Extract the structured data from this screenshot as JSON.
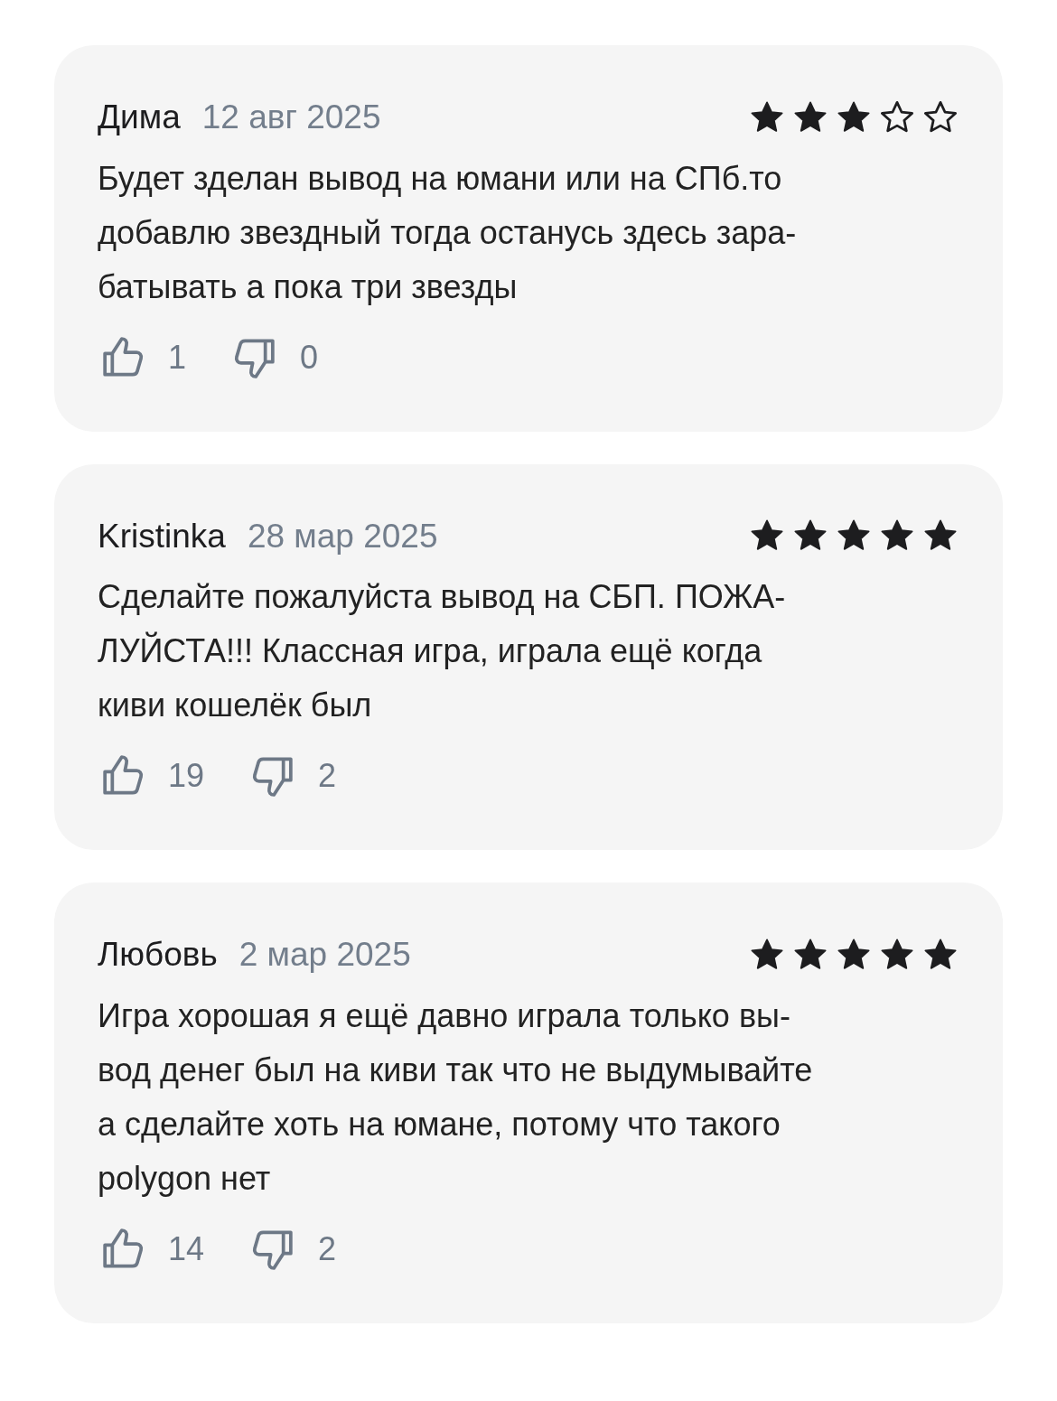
{
  "reviews": [
    {
      "author": "Дима",
      "date": "12 авг 2025",
      "stars": 3,
      "lines": [
        "Будет зделан вывод на юмани или на СПб.то",
        "добавлю звездный тогда останусь здесь зара-",
        "батывать а пока три звезды"
      ],
      "likes": "1",
      "dislikes": "0"
    },
    {
      "author": "Kristinka",
      "date": "28 мар 2025",
      "stars": 5,
      "lines": [
        "Сделайте пожалуйста вывод на СБП. ПОЖА-",
        "ЛУЙСТА!!! Классная игра, играла ещё когда",
        "киви кошелёк был"
      ],
      "likes": "19",
      "dislikes": "2"
    },
    {
      "author": "Любовь",
      "date": "2 мар 2025",
      "stars": 5,
      "lines": [
        "Игра хорошая я ещё давно играла только вы-",
        "вод денег был на киви так что не выдумывайте",
        "а сделайте хоть на юмане, потому что такого",
        "polygon нет"
      ],
      "likes": "14",
      "dislikes": "2"
    }
  ]
}
